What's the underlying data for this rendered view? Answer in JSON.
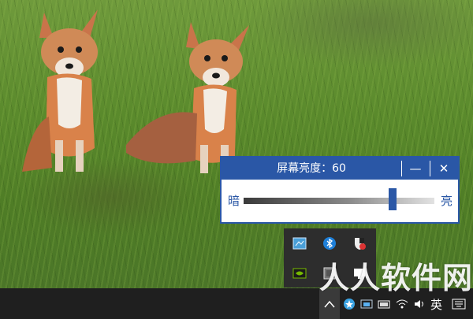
{
  "brightness_window": {
    "title": "屏幕亮度：60",
    "minimize_label": "—",
    "close_label": "✕",
    "left_label": "暗",
    "right_label": "亮",
    "level": 60,
    "range": [
      0,
      100
    ]
  },
  "tray_popup": {
    "icons": [
      "display-settings-icon",
      "bluetooth-icon",
      "security-shield-icon",
      "nvidia-icon",
      "system-monitor-icon",
      "screen-icon"
    ]
  },
  "taskbar": {
    "icons": [
      "show-hidden-icons-caret",
      "app-star-icon",
      "windows-security-icon",
      "network-icon",
      "wifi-icon",
      "volume-icon"
    ],
    "ime_label": "英",
    "keyboard_icon": "keyboard-icon"
  },
  "watermark": {
    "text": "人人软件网"
  },
  "colors": {
    "accent": "#2a57a6",
    "taskbar": "#1f1f1f",
    "tray_popup": "#2d2d2d"
  }
}
